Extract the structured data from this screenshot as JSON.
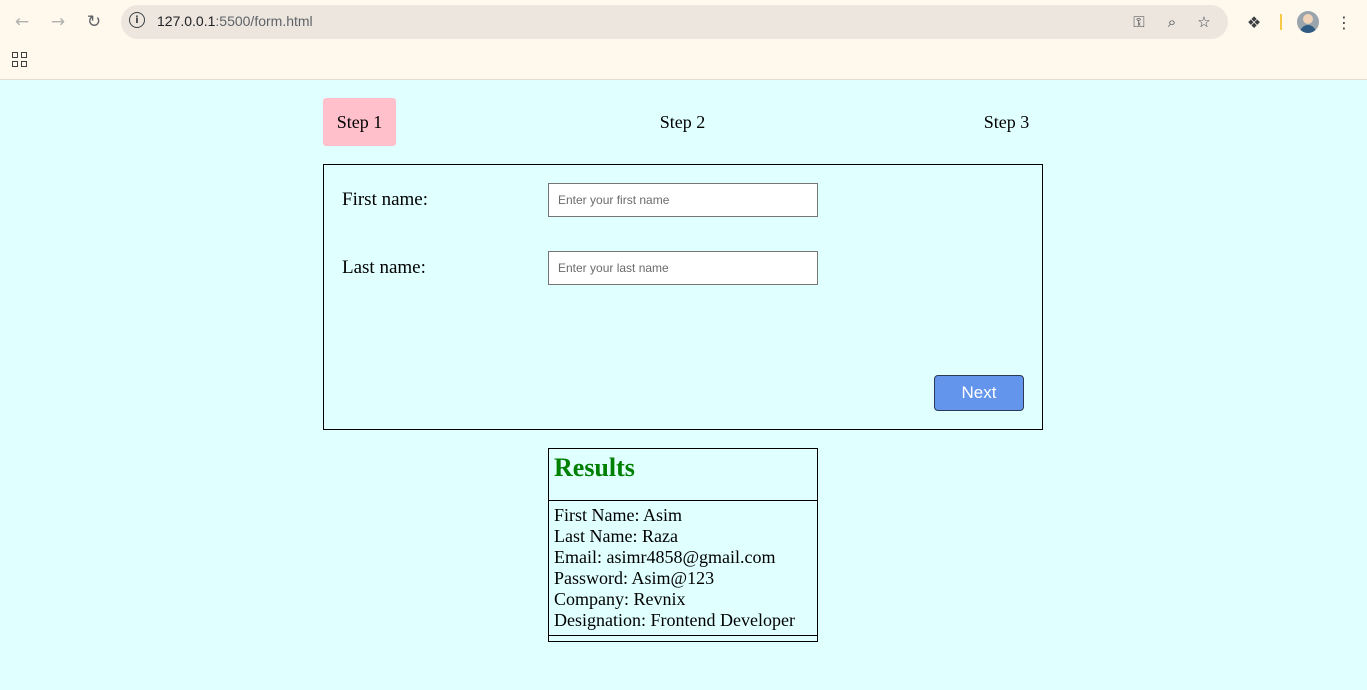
{
  "browser": {
    "url_host": "127.0.0.1",
    "url_path": ":5500/form.html"
  },
  "steps": [
    {
      "label": "Step 1",
      "active": true
    },
    {
      "label": "Step 2",
      "active": false
    },
    {
      "label": "Step 3",
      "active": false
    }
  ],
  "form": {
    "first_name_label": "First name:",
    "first_name_placeholder": "Enter your first name",
    "first_name_value": "",
    "last_name_label": "Last name:",
    "last_name_placeholder": "Enter your last name",
    "last_name_value": "",
    "next_label": "Next"
  },
  "results": {
    "title": "Results",
    "lines": [
      "First Name: Asim",
      "Last Name: Raza",
      "Email: asimr4858@gmail.com",
      "Password: Asim@123",
      "Company: Revnix",
      "Designation: Frontend Developer"
    ]
  },
  "colors": {
    "page_bg": "#e0ffff",
    "active_step": "#ffc0cb",
    "next_button": "#6495ed",
    "results_title": "#008000"
  }
}
